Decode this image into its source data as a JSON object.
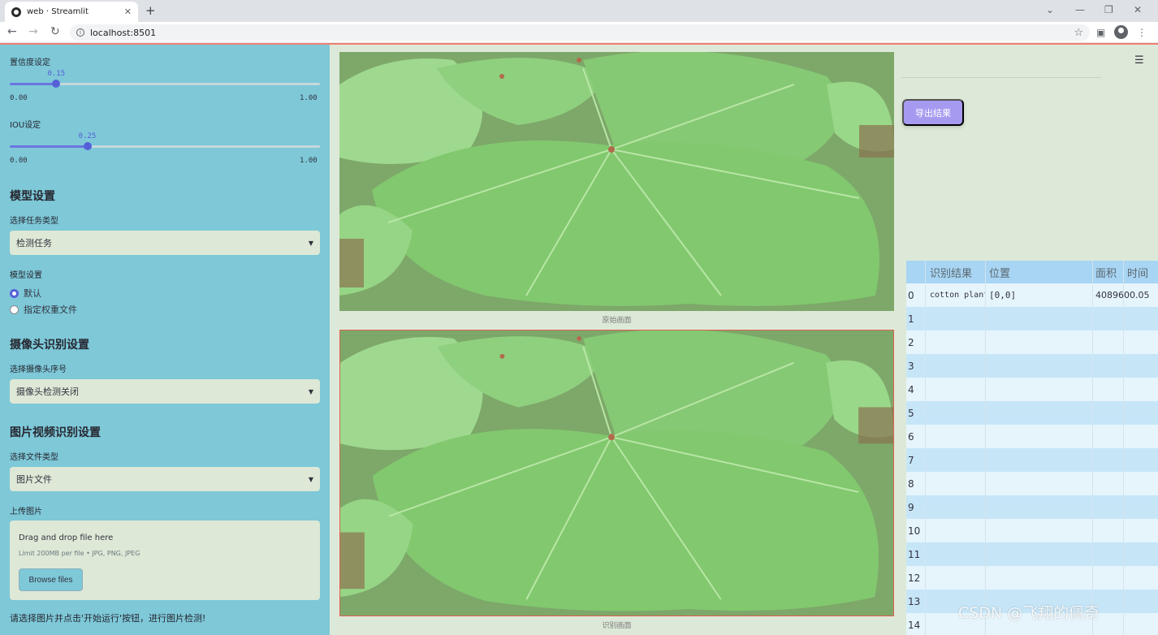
{
  "browser": {
    "tab_title": "web · Streamlit",
    "url": "localhost:8501"
  },
  "sidebar": {
    "confidence": {
      "label": "置信度设定",
      "value": 0.15,
      "value_text": "0.15",
      "min": "0.00",
      "max": "1.00"
    },
    "iou": {
      "label": "IOU设定",
      "value": 0.25,
      "value_text": "0.25",
      "min": "0.00",
      "max": "1.00"
    },
    "model_section": "模型设置",
    "task_label": "选择任务类型",
    "task_value": "检测任务",
    "model_label": "模型设置",
    "model_options": [
      "默认",
      "指定权重文件"
    ],
    "camera_section": "摄像头识别设置",
    "camera_label": "选择摄像头序号",
    "camera_value": "摄像头检测关闭",
    "media_section": "图片视频识别设置",
    "filetype_label": "选择文件类型",
    "filetype_value": "图片文件",
    "upload_label": "上传图片",
    "upload_main": "Drag and drop file here",
    "upload_sub": "Limit 200MB per file • JPG, PNG, JPEG",
    "browse_label": "Browse files",
    "hint": "请选择图片并点击'开始运行'按钮，进行图片检测!"
  },
  "main": {
    "caption_original": "原始画面",
    "caption_result": "识别画面",
    "export_label": "导出结果"
  },
  "table": {
    "headers": [
      "",
      "识别结果",
      "位置",
      "面积",
      "时间"
    ],
    "rows": [
      {
        "idx": "0",
        "name": "cotton plant",
        "pos": "[0,0]",
        "area": "4089600.05",
        "time": ""
      },
      {
        "idx": "1"
      },
      {
        "idx": "2"
      },
      {
        "idx": "3"
      },
      {
        "idx": "4"
      },
      {
        "idx": "5"
      },
      {
        "idx": "6"
      },
      {
        "idx": "7"
      },
      {
        "idx": "8"
      },
      {
        "idx": "9"
      },
      {
        "idx": "10"
      },
      {
        "idx": "11"
      },
      {
        "idx": "12"
      },
      {
        "idx": "13"
      },
      {
        "idx": "14"
      }
    ]
  },
  "watermark": "CSDN @飞翔的佩奇",
  "colors": {
    "sidebar": "#7ec8d8",
    "accent": "#5560d8",
    "export": "#a69af0",
    "table_header": "#a8d5f3"
  }
}
